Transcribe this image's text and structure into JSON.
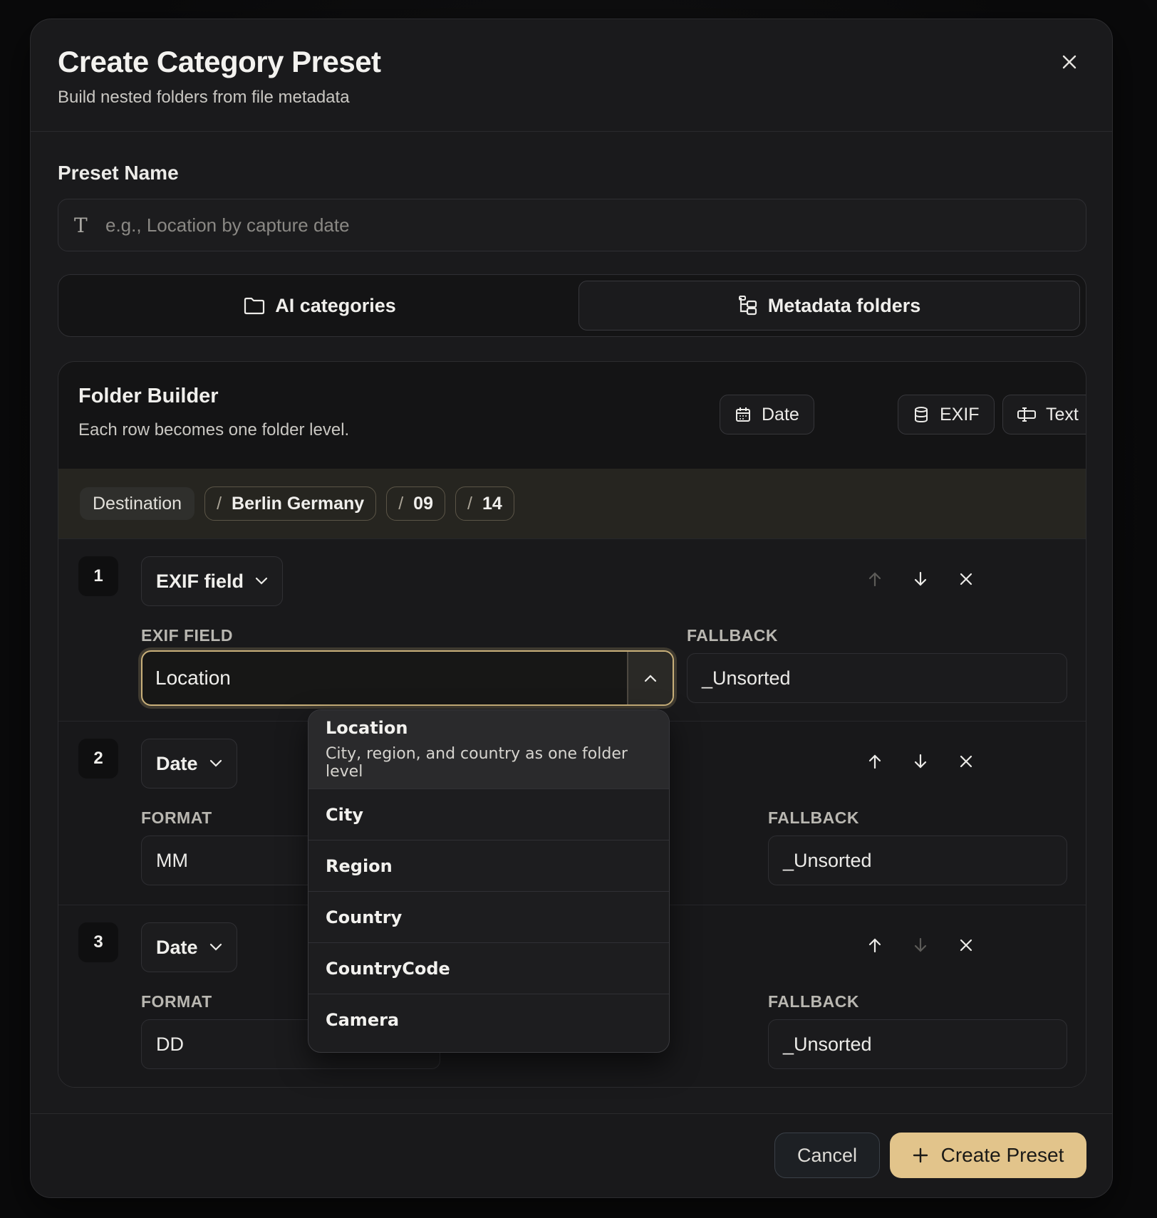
{
  "dialog": {
    "title": "Create Category Preset",
    "subtitle": "Build nested folders from file metadata"
  },
  "preset_name": {
    "label": "Preset Name",
    "value": "",
    "placeholder": "e.g., Location by capture date"
  },
  "mode_tabs": {
    "ai_label": "AI categories",
    "metadata_label": "Metadata folders",
    "selected": "Metadata folders"
  },
  "builder": {
    "title": "Folder Builder",
    "subtitle": "Each row becomes one folder level.",
    "add_buttons": {
      "date": "Date",
      "exif": "EXIF",
      "text": "Text"
    },
    "destination": {
      "label": "Destination",
      "segments": [
        "Berlin Germany",
        "09",
        "14"
      ],
      "separator": "/"
    },
    "rows": [
      {
        "number": "1",
        "type": "EXIF field",
        "field_label": "EXIF FIELD",
        "field_value": "Location",
        "fallback_label": "FALLBACK",
        "fallback_value": "_Unsorted"
      },
      {
        "number": "2",
        "type": "Date",
        "field_label": "FORMAT",
        "field_value": "MM",
        "fallback_label": "FALLBACK",
        "fallback_value": "_Unsorted"
      },
      {
        "number": "3",
        "type": "Date",
        "field_label": "FORMAT",
        "field_value": "DD",
        "fallback_label": "FALLBACK",
        "fallback_value": "_Unsorted"
      }
    ]
  },
  "dropdown": {
    "selected": {
      "label": "Location",
      "description": "City, region, and country as one folder level"
    },
    "options": [
      "City",
      "Region",
      "Country",
      "CountryCode",
      "Camera"
    ]
  },
  "footer": {
    "cancel_label": "Cancel",
    "create_label": "Create Preset"
  },
  "colors": {
    "accent": "#e2c48b",
    "focus_ring": "#c9b07a",
    "surface": "#1a1a1c",
    "destination_bar": "#262520"
  },
  "icons": [
    "close-icon",
    "text-type-icon",
    "folder-icon",
    "folder-tree-icon",
    "calendar-icon",
    "database-icon",
    "text-cursor-icon",
    "chevron-down-icon",
    "chevron-up-icon",
    "arrow-up-icon",
    "arrow-down-icon",
    "plus-icon"
  ]
}
